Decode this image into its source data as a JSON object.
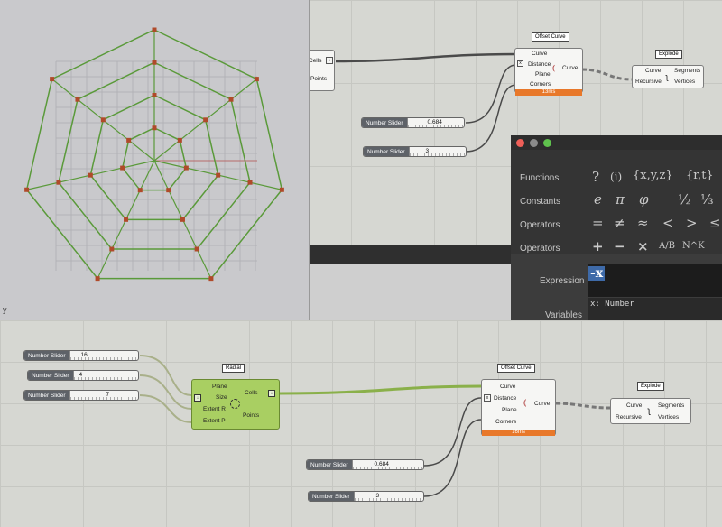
{
  "top_canvas": {
    "partial_component": {
      "cells": "Cells",
      "points": "Points"
    },
    "offset": {
      "title": "Offset Curve",
      "inputs": [
        "Curve",
        "Distance",
        "Plane",
        "Corners"
      ],
      "output": "Curve",
      "timing": "13ms"
    },
    "explode": {
      "title": "Explode",
      "inputs": [
        "Curve",
        "Recursive"
      ],
      "outputs": [
        "Segments",
        "Vertices"
      ]
    },
    "slider1": {
      "name": "Number Slider",
      "value": "0.684"
    },
    "slider2": {
      "name": "Number Slider",
      "value": "3"
    }
  },
  "expression_editor": {
    "rows": [
      {
        "label": "Functions",
        "symbols": [
          "?",
          "(i)",
          "{x,y,z}",
          "{r,t}"
        ]
      },
      {
        "label": "Constants",
        "symbols": [
          "e",
          "π",
          "φ",
          "½",
          "⅓"
        ]
      },
      {
        "label": "Operators",
        "symbols": [
          "=",
          "≠",
          "≈",
          "<",
          ">",
          "≤"
        ]
      },
      {
        "label": "Operators",
        "symbols": [
          "+",
          "−",
          "×",
          "A/B",
          "N^K"
        ]
      }
    ],
    "expression_label": "Expression",
    "expression_value": "-x",
    "variables_label": "Variables",
    "variables_value": "x: Number"
  },
  "bottom_canvas": {
    "sliders": [
      {
        "name": "Number Slider",
        "value": "16"
      },
      {
        "name": "Number Slider",
        "value": "4"
      },
      {
        "name": "Number Slider",
        "value": "7"
      }
    ],
    "radial": {
      "title": "Radial",
      "inputs": [
        "Plane",
        "Size",
        "Extent R",
        "Extent P"
      ],
      "outputs": [
        "Cells",
        "Points"
      ]
    },
    "offset": {
      "title": "Offset Curve",
      "inputs": [
        "Curve",
        "Distance",
        "Plane",
        "Corners"
      ],
      "output": "Curve",
      "timing": "16ms"
    },
    "explode": {
      "title": "Explode",
      "inputs": [
        "Curve",
        "Recursive"
      ],
      "outputs": [
        "Segments",
        "Vertices"
      ]
    },
    "slider_distance": {
      "name": "Number Slider",
      "value": "0.684"
    },
    "slider_corners": {
      "name": "Number Slider",
      "value": "3"
    }
  },
  "viewport": {
    "axis_label": "y"
  },
  "colors": {
    "wire_green": "#8ab04a",
    "wire_dark": "#4a4a4a",
    "timing": "#e8782a",
    "edge": "#5a9a3a",
    "vertex": "#b04a2a"
  }
}
